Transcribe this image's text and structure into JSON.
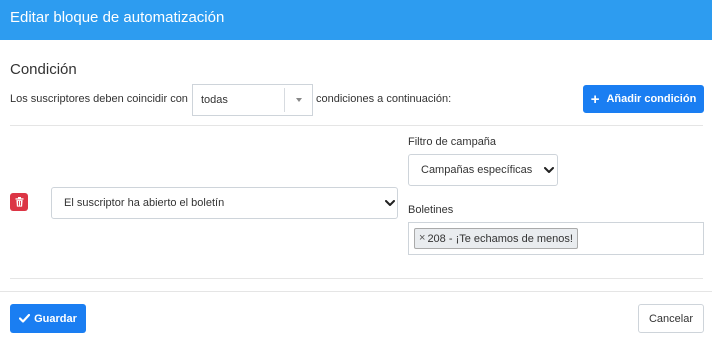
{
  "modal": {
    "title": "Editar bloque de automatización"
  },
  "condition_section": {
    "title": "Condición",
    "match_prefix": "Los suscriptores deben coincidir con",
    "match_value": "todas",
    "match_suffix": "condiciones a continuación:",
    "add_condition_label": "Añadir condición"
  },
  "condition_row": {
    "condition_value": "El suscriptor ha abierto el boletín",
    "campaign_filter_label": "Filtro de campaña",
    "campaign_filter_value": "Campañas específicas",
    "newsletters_label": "Boletines",
    "newsletters_tags": [
      {
        "remove": "×",
        "label": "208 - ¡Te echamos de menos!"
      }
    ]
  },
  "footer": {
    "save_label": "Guardar",
    "cancel_label": "Cancelar"
  },
  "icons": {
    "add": "plus-icon",
    "delete": "trash-icon",
    "save": "check-icon",
    "select": "chevron-down-icon",
    "dropdown": "caret-down-icon"
  },
  "colors": {
    "header": "#2d9cf0",
    "primary": "#1a7ef2",
    "danger": "#dc3545"
  }
}
